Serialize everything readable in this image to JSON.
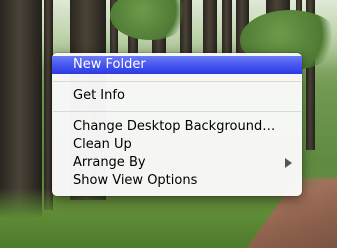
{
  "context_menu": {
    "items": [
      {
        "label": "New Folder",
        "highlighted": true
      },
      {
        "label": "Get Info"
      },
      {
        "label": "Change Desktop Background…"
      },
      {
        "label": "Clean Up"
      },
      {
        "label": "Arrange By",
        "has_submenu": true
      },
      {
        "label": "Show View Options"
      }
    ]
  },
  "colors": {
    "highlight": "#3a49ea",
    "menu_background": "#fafafa"
  },
  "icons": {
    "submenu": "chevron-right-icon"
  }
}
